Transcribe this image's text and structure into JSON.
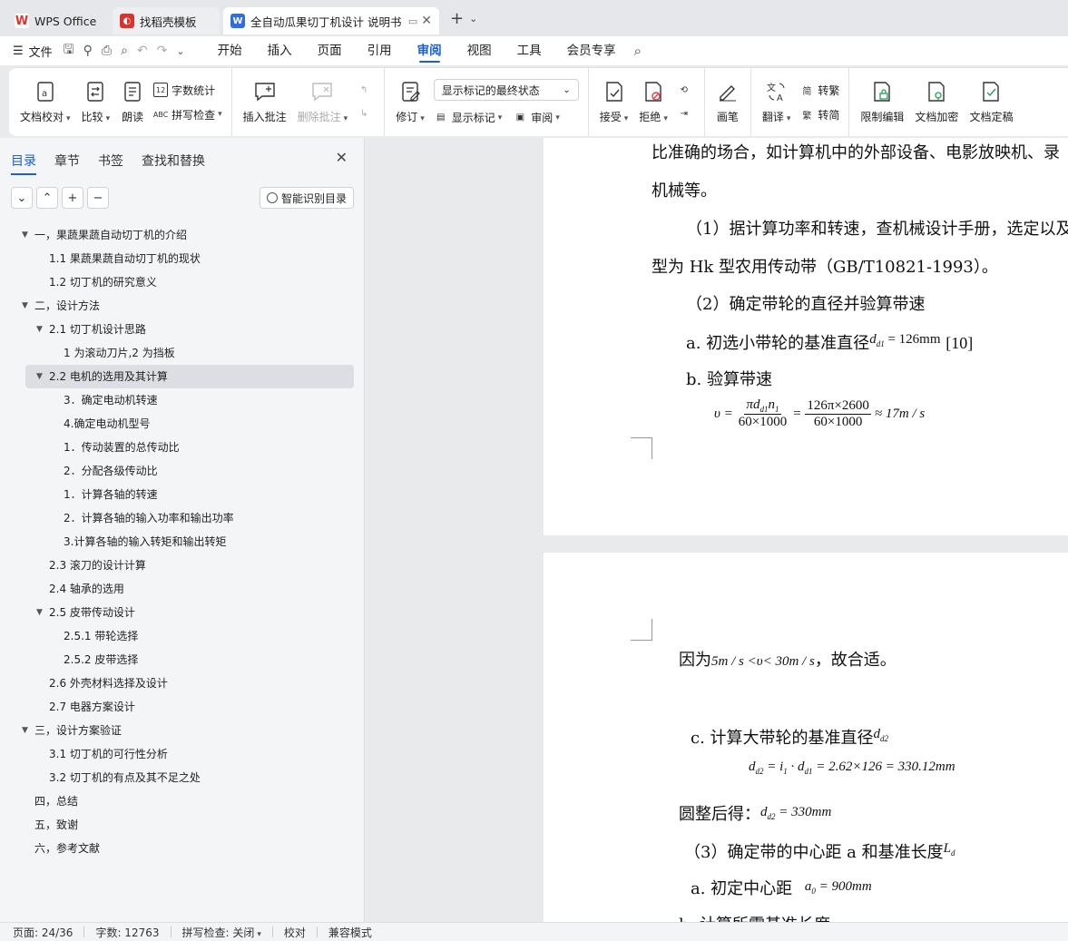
{
  "tabs": [
    {
      "label": "WPS Office",
      "icon": "wps-logo-icon"
    },
    {
      "label": "找稻壳模板",
      "icon": "docer-icon"
    },
    {
      "label": "全自动瓜果切丁机设计 说明书",
      "icon": "writer-doc-icon"
    }
  ],
  "menubar": {
    "file": "文件",
    "tabs": [
      "开始",
      "插入",
      "页面",
      "引用",
      "审阅",
      "视图",
      "工具",
      "会员专享"
    ],
    "active": "审阅"
  },
  "ribbon": {
    "proofread": "文档校对",
    "compare": "比较",
    "read_aloud": "朗读",
    "word_count": "字数统计",
    "spell_check": "拼写检查",
    "insert_comment": "插入批注",
    "delete_comment": "删除批注",
    "revise": "修订",
    "markup_state": "显示标记的最终状态",
    "show_markup": "显示标记",
    "review": "审阅",
    "accept": "接受",
    "reject": "拒绝",
    "pen": "画笔",
    "translate": "翻译",
    "to_traditional": "转繁",
    "to_simplified": "转简",
    "restrict_edit": "限制编辑",
    "encrypt": "文档加密",
    "finalize": "文档定稿"
  },
  "sidebar": {
    "tabs": [
      "目录",
      "章节",
      "书签",
      "查找和替换"
    ],
    "active_tab": "目录",
    "smart_toc": "智能识别目录",
    "toc": [
      {
        "text": "一，果蔬果蔬自动切丁机的介绍",
        "level": 1,
        "arrow": true
      },
      {
        "text": "1.1 果蔬果蔬自动切丁机的现状",
        "level": 2
      },
      {
        "text": "1.2 切丁机的研究意义",
        "level": 2
      },
      {
        "text": "二，设计方法",
        "level": 1,
        "arrow": true
      },
      {
        "text": "2.1 切丁机设计思路",
        "level": 2,
        "arrow": true
      },
      {
        "text": "1 为滚动刀片,2 为挡板",
        "level": 3
      },
      {
        "text": "2.2 电机的选用及其计算",
        "level": 2,
        "arrow": true,
        "selected": true
      },
      {
        "text": "3．确定电动机转速",
        "level": 3
      },
      {
        "text": "4.确定电动机型号",
        "level": 3
      },
      {
        "text": "1．传动装置的总传动比",
        "level": 3
      },
      {
        "text": "2．分配各级传动比",
        "level": 3
      },
      {
        "text": "1．计算各轴的转速",
        "level": 3
      },
      {
        "text": "2．计算各轴的输入功率和输出功率",
        "level": 3
      },
      {
        "text": "3.计算各轴的输入转矩和输出转矩",
        "level": 3
      },
      {
        "text": "2.3 滚刀的设计计算",
        "level": 2
      },
      {
        "text": "2.4 轴承的选用",
        "level": 2
      },
      {
        "text": "2.5 皮带传动设计",
        "level": 2,
        "arrow": true
      },
      {
        "text": "2.5.1 带轮选择",
        "level": 3
      },
      {
        "text": "2.5.2 皮带选择",
        "level": 3
      },
      {
        "text": "2.6 外壳材料选择及设计",
        "level": 2
      },
      {
        "text": "2.7 电器方案设计",
        "level": 2
      },
      {
        "text": "三，设计方案验证",
        "level": 1,
        "arrow": true
      },
      {
        "text": "3.1 切丁机的可行性分析",
        "level": 2
      },
      {
        "text": "3.2 切丁机的有点及其不足之处",
        "level": 2
      },
      {
        "text": "四，总结",
        "level": 1
      },
      {
        "text": "五，致谢",
        "level": 1
      },
      {
        "text": "六，参考文献",
        "level": 1
      }
    ]
  },
  "document": {
    "page1": {
      "line1": "比准确的场合，如计算机中的外部设备、电影放映机、录",
      "line2": "机械等。",
      "line3": "（1）据计算功率和转速，查机械设计手册，选定以及",
      "line4": "型为 Hk 型农用传动带（GB/T10821-1993）。",
      "line5": "（2）确定带轮的直径并验算带速",
      "item_a": "a.  初选小带轮的基准直径",
      "item_a_math": "d",
      "item_a_sub": "d1",
      "item_a_val": "= 126mm",
      "item_a_ref": "[10]",
      "item_b": "b.  验算带速",
      "eq_lhs": "υ =",
      "eq_num1": "πd",
      "eq_num1_sub": "d1",
      "eq_num1_n": "n",
      "eq_num1_n_sub": "1",
      "eq_den1": "60×1000",
      "eq_eq": "=",
      "eq_num2": "126π×2600",
      "eq_den2": "60×1000",
      "eq_rhs": "≈ 17m / s"
    },
    "page2": {
      "since": "因为",
      "since_math": "5m / s <υ< 30m / s",
      "since_end": "，故合适。",
      "item_c": "c.  计算大带轮的基准直径",
      "item_c_math": "d",
      "item_c_sub": "d2",
      "eq2": "d",
      "eq2_sub": "d2",
      "eq2_mid": "= i",
      "eq2_mid_sub": "1",
      "eq2_mid2": "· d",
      "eq2_mid2_sub": "d1",
      "eq2_rhs": "= 2.62×126 = 330.12mm",
      "round": "圆整后得：",
      "round_math": "d",
      "round_sub": "d2",
      "round_val": "= 330mm",
      "step3": "（3）确定带的中心距 a 和基准长度",
      "step3_math": "L",
      "step3_sub": "d",
      "item_a2": "a.  初定中心距",
      "item_a2_math": "a",
      "item_a2_sub": "0",
      "item_a2_val": "= 900mm",
      "item_b2": "b.  计算所需基准长度"
    }
  },
  "statusbar": {
    "page": "页面: 24/36",
    "words": "字数: 12763",
    "spell": "拼写检查: 关闭",
    "proof": "校对",
    "compat": "兼容模式"
  },
  "colors": {
    "accent": "#1a5fd6",
    "wps_red": "#e3312d",
    "docer_red": "#d9342b",
    "writer_blue": "#2f6ee0"
  }
}
